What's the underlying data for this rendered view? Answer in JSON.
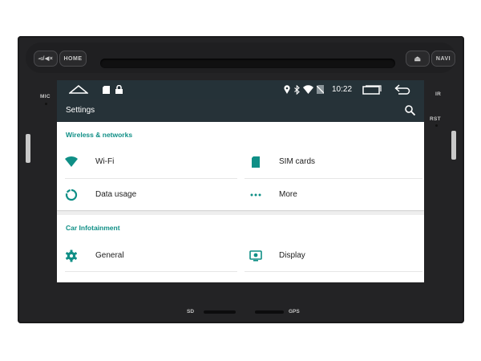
{
  "hardware": {
    "back_label": "◅/◀×",
    "home_label": "HOME",
    "eject_label": "⏏",
    "navi_label": "NAVI",
    "mic_label": "MIC",
    "ir_label": "IR",
    "rst_label": "RST",
    "sd_label": "SD",
    "gps_label": "GPS"
  },
  "statusbar": {
    "time": "10:22",
    "icons": [
      "home-outline-icon",
      "sd-card-icon",
      "lock-icon",
      "location-icon",
      "bluetooth-icon",
      "wifi-icon",
      "sim-off-icon",
      "recent-apps-icon",
      "back-icon"
    ]
  },
  "actionbar": {
    "title": "Settings",
    "search_icon": "search-icon"
  },
  "sections": [
    {
      "title": "Wireless & networks",
      "items": [
        {
          "label": "Wi-Fi",
          "icon": "wifi-icon"
        },
        {
          "label": "SIM cards",
          "icon": "sim-card-icon"
        },
        {
          "label": "Data usage",
          "icon": "data-usage-icon"
        },
        {
          "label": "More",
          "icon": "more-dots-icon"
        }
      ]
    },
    {
      "title": "Car Infotainment",
      "items": [
        {
          "label": "General",
          "icon": "gear-icon"
        },
        {
          "label": "Display",
          "icon": "display-icon"
        }
      ]
    }
  ],
  "colors": {
    "accent": "#0f8f86",
    "statusbar": "#253238",
    "actionbar": "#263238",
    "bezel": "#232325"
  }
}
